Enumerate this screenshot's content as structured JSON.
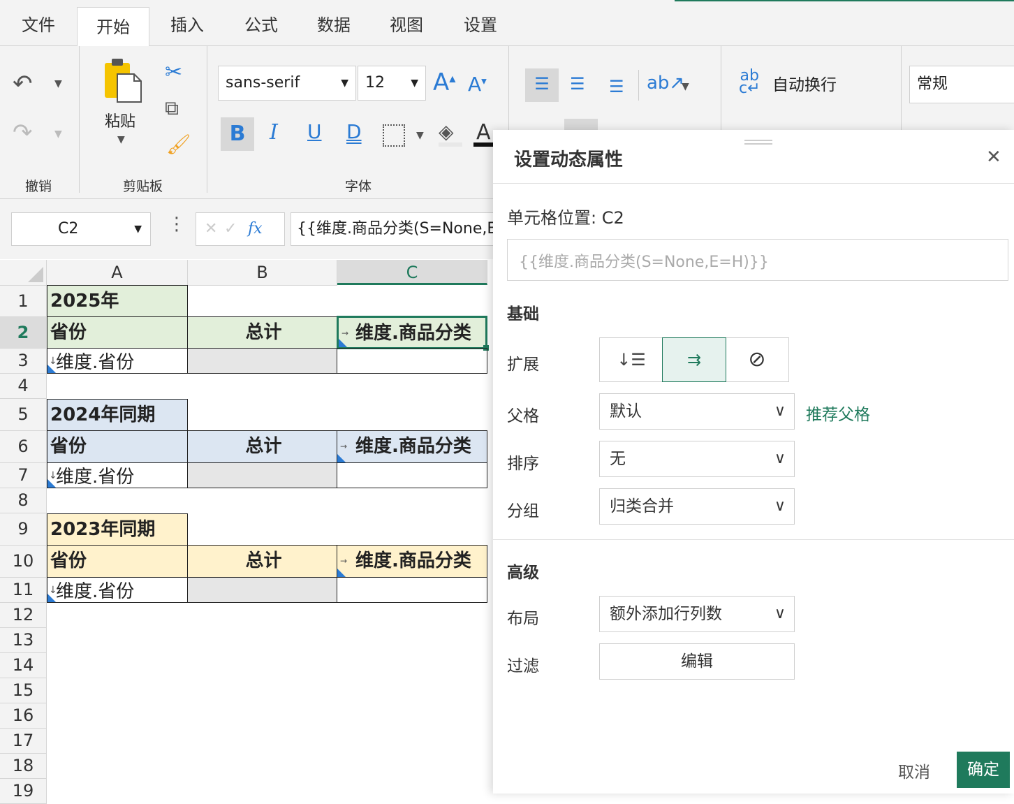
{
  "menu": {
    "tabs": [
      "文件",
      "开始",
      "插入",
      "公式",
      "数据",
      "视图",
      "设置"
    ],
    "active": "开始"
  },
  "ribbon": {
    "undo_group": "撤销",
    "clipboard_group": "剪贴板",
    "paste_label": "粘贴",
    "font_group": "字体",
    "font_family": "sans-serif",
    "font_size": "12",
    "wrap_text": "自动换行",
    "number_format": "常规",
    "font_grow": "A",
    "font_shrink": "A",
    "bold": "B",
    "italic": "I",
    "underline": "U",
    "double_underline": "D",
    "font_color": "A"
  },
  "formula_bar": {
    "cell_ref": "C2",
    "fx": "fx",
    "formula": "{{维度.商品分类(S=None,E"
  },
  "grid": {
    "columns": [
      "A",
      "B",
      "C"
    ],
    "rows": [
      "1",
      "2",
      "3",
      "4",
      "5",
      "6",
      "7",
      "8",
      "9",
      "10",
      "11",
      "12",
      "13",
      "14",
      "15",
      "16",
      "17",
      "18",
      "19"
    ],
    "a1": "2025年",
    "a2": "省份",
    "b2": "总计",
    "c2": "维度.商品分类",
    "a3": "维度.省份",
    "a5": "2024年同期",
    "a6": "省份",
    "b6": "总计",
    "c6": "维度.商品分类",
    "a7": "维度.省份",
    "a9": "2023年同期",
    "a10": "省份",
    "b10": "总计",
    "c10": "维度.商品分类",
    "a11": "维度.省份"
  },
  "dialog": {
    "title": "设置动态属性",
    "cell_position": "单元格位置: C2",
    "expression": "{{维度.商品分类(S=None,E=H)}}",
    "basic_section": "基础",
    "expand_label": "扩展",
    "parent_label": "父格",
    "parent_value": "默认",
    "recommend_parent": "推荐父格",
    "sort_label": "排序",
    "sort_value": "无",
    "group_label": "分组",
    "group_value": "归类合并",
    "advanced_section": "高级",
    "layout_label": "布局",
    "layout_value": "额外添加行列数",
    "filter_label": "过滤",
    "filter_button": "编辑",
    "cancel": "取消",
    "confirm": "确定"
  },
  "colors": {
    "accent": "#1f7a5c",
    "green_fill": "#e2efda",
    "blue_fill": "#dce6f2",
    "yellow_fill": "#fff2cc",
    "gray_fill": "#e6e6e6",
    "icon_blue": "#2b7bd4"
  }
}
